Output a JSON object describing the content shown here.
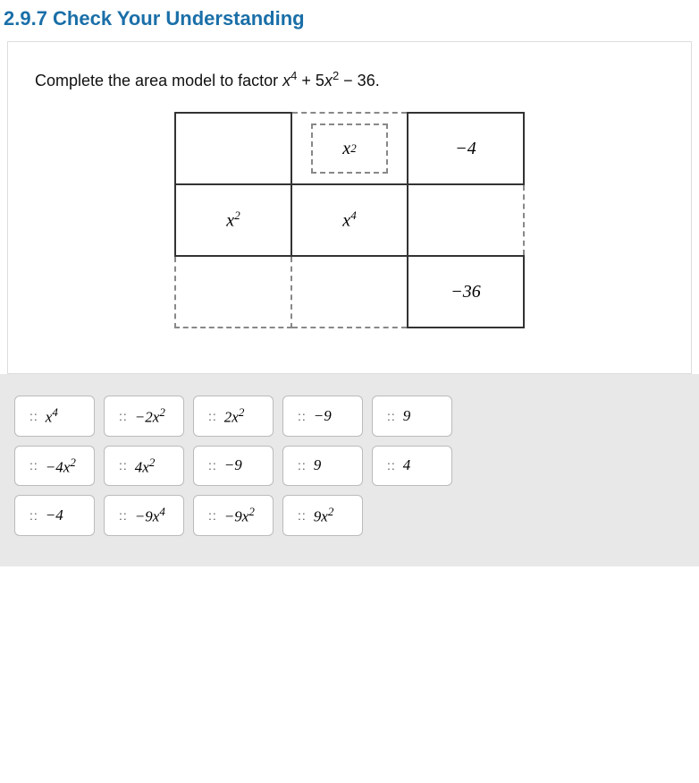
{
  "title": "2.9.7 Check Your Understanding",
  "problem": {
    "instruction": "Complete the area model to factor",
    "expression": "x⁴ + 5x² − 36."
  },
  "grid": {
    "header_col1": "",
    "header_col2": "x²",
    "header_col3": "−4",
    "row1_col1": "x²",
    "row1_col2": "x⁴",
    "row1_col3": "",
    "row2_col1": "",
    "row2_col2": "",
    "row2_col3": "−36"
  },
  "tiles": {
    "row1": [
      {
        "dots": "::",
        "label": "x⁴"
      },
      {
        "dots": "::",
        "label": "−2x²"
      },
      {
        "dots": "::",
        "label": "2x²"
      },
      {
        "dots": "::",
        "label": "−9"
      },
      {
        "dots": "::",
        "label": "9"
      }
    ],
    "row2": [
      {
        "dots": "::",
        "label": "−4x²"
      },
      {
        "dots": "::",
        "label": "4x²"
      },
      {
        "dots": "::",
        "label": "−9"
      },
      {
        "dots": "::",
        "label": "9"
      },
      {
        "dots": "::",
        "label": "4"
      }
    ],
    "row3": [
      {
        "dots": "::",
        "label": "−4"
      },
      {
        "dots": "::",
        "label": "−9x⁴"
      },
      {
        "dots": "::",
        "label": "−9x²"
      },
      {
        "dots": "::",
        "label": "9x²"
      }
    ]
  }
}
